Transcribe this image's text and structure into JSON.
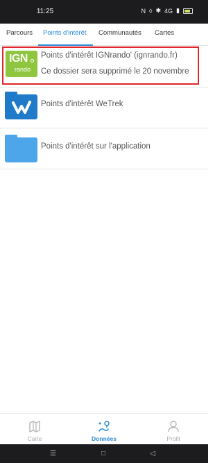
{
  "status": {
    "time": "11:25",
    "battery": "battery",
    "icons": [
      "nfc-icon",
      "vibrate-icon",
      "bluetooth-icon",
      "signal-icon",
      "battery-icon"
    ],
    "network_text": "4G"
  },
  "tabs": [
    {
      "label": "Parcours",
      "active": false
    },
    {
      "label": "Points d'intérêt",
      "active": true
    },
    {
      "label": "Communautés",
      "active": false
    },
    {
      "label": "Cartes",
      "active": false
    }
  ],
  "folders": [
    {
      "title": "Points d'intérêt IGNrando' (ignrando.fr)",
      "subtitle": "Ce dossier sera supprimé le 20 novembre",
      "icon": "ign-rando-logo"
    },
    {
      "title": "Points d'intérêt WeTrek",
      "icon": "wetrek-folder-icon"
    },
    {
      "title": "Points d'intérêt sur l'application",
      "icon": "folder-icon"
    }
  ],
  "ign_logo": {
    "text": "IGN",
    "subtext": "rando"
  },
  "bottom_nav": [
    {
      "label": "Carte",
      "icon": "map-icon",
      "active": false
    },
    {
      "label": "Données",
      "icon": "data-route-icon",
      "active": true
    },
    {
      "label": "Profil",
      "icon": "profile-icon",
      "active": false
    }
  ],
  "colors": {
    "accent": "#2a8ad4",
    "highlight": "#e1262a",
    "ign_green": "#8ec63f",
    "folder_dark": "#1f7bc9",
    "folder_light": "#4ea6ea"
  }
}
